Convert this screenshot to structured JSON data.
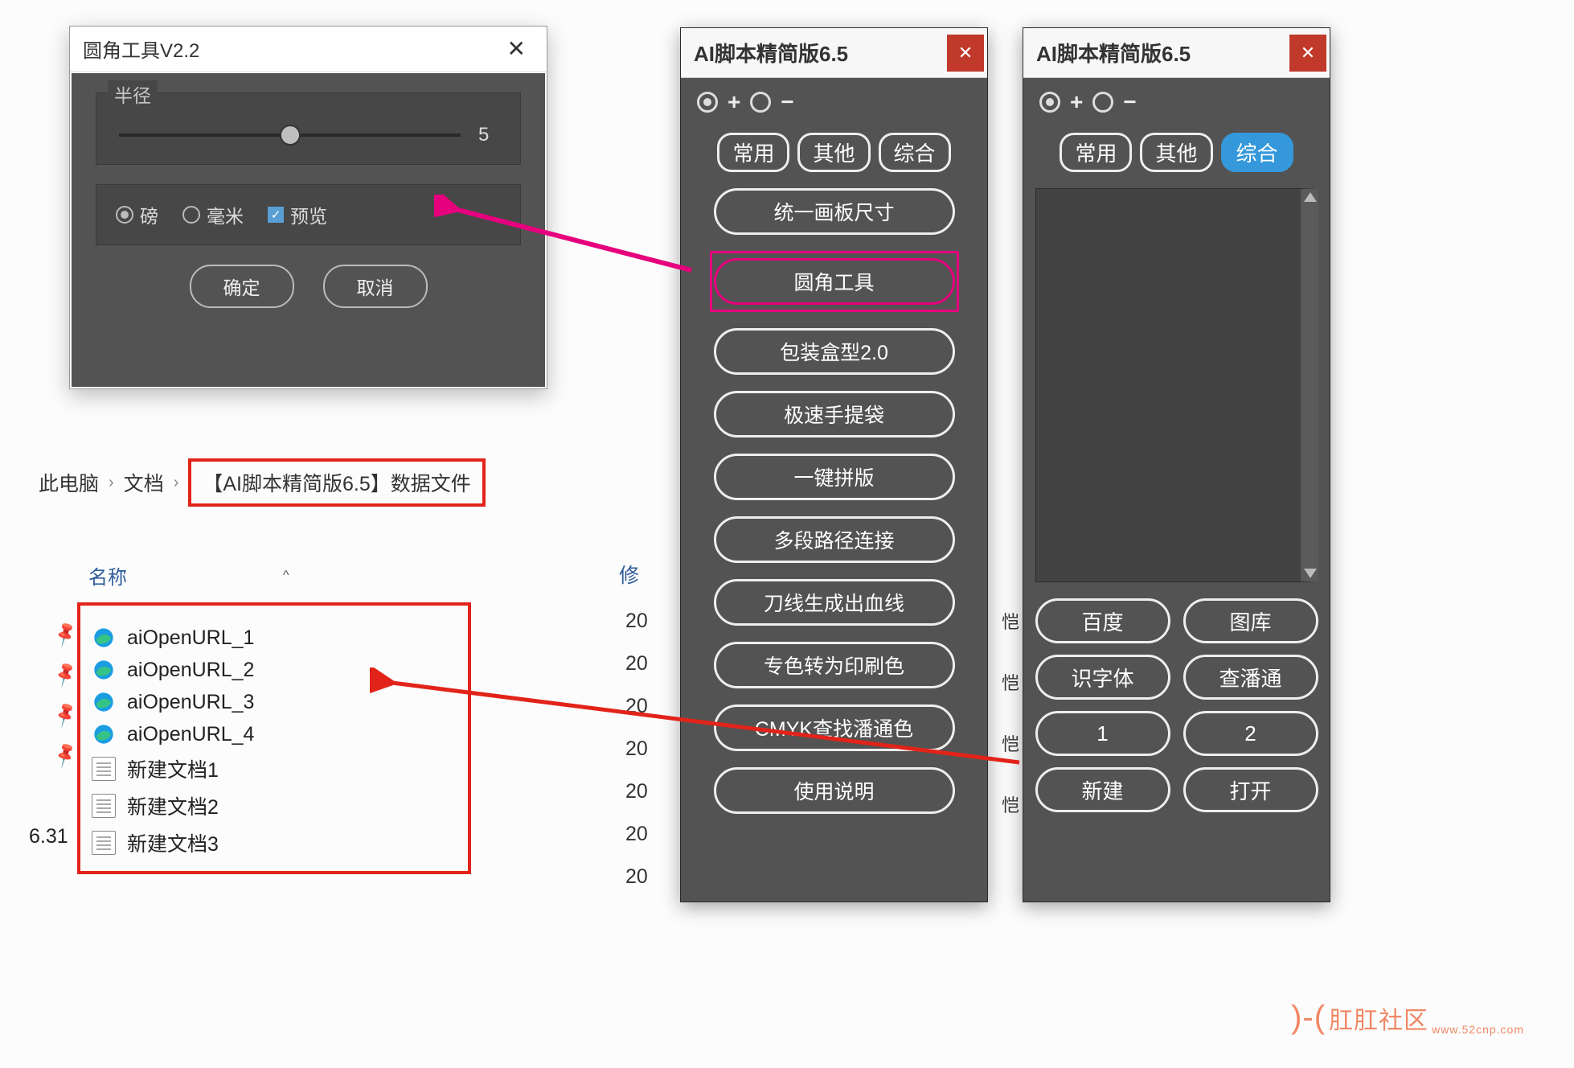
{
  "dialog": {
    "title": "圆角工具V2.2",
    "radius_label": "半径",
    "radius_value": "5",
    "unit_pt": "磅",
    "unit_mm": "毫米",
    "preview": "预览",
    "ok": "确定",
    "cancel": "取消"
  },
  "breadcrumb": {
    "root": "此电脑",
    "docs": "文档",
    "folder": "【AI脚本精简版6.5】数据文件"
  },
  "list": {
    "col_name": "名称",
    "col_mod": "修",
    "files": [
      {
        "icon": "edge",
        "name": "aiOpenURL_1",
        "date": "20"
      },
      {
        "icon": "edge",
        "name": "aiOpenURL_2",
        "date": "20"
      },
      {
        "icon": "edge",
        "name": "aiOpenURL_3",
        "date": "20"
      },
      {
        "icon": "edge",
        "name": "aiOpenURL_4",
        "date": "20"
      },
      {
        "icon": "doc",
        "name": "新建文档1",
        "date": "20"
      },
      {
        "icon": "doc",
        "name": "新建文档2",
        "date": "20"
      },
      {
        "icon": "doc",
        "name": "新建文档3",
        "date": "20"
      }
    ],
    "extra_left": "6.31"
  },
  "sidechars": [
    "恺",
    "恺",
    "恺",
    "恺"
  ],
  "panelA": {
    "title": "AI脚本精简版6.5",
    "plus": "+",
    "minus": "−",
    "tabs": [
      "常用",
      "其他",
      "综合"
    ],
    "buttons": [
      "统一画板尺寸",
      "圆角工具",
      "包装盒型2.0",
      "极速手提袋",
      "一键拼版",
      "多段路径连接",
      "刀线生成出血线",
      "专色转为印刷色",
      "CMYK查找潘通色",
      "使用说明"
    ],
    "highlightIndex": 1
  },
  "panelB": {
    "title": "AI脚本精简版6.5",
    "plus": "+",
    "minus": "−",
    "tabs": [
      "常用",
      "其他",
      "综合"
    ],
    "activeTab": 2,
    "grid": [
      "百度",
      "图库",
      "识字体",
      "查潘通",
      "1",
      "2",
      "新建",
      "打开"
    ]
  },
  "watermark": {
    "big": "肛肛社区",
    "small": "www.52cnp.com"
  }
}
